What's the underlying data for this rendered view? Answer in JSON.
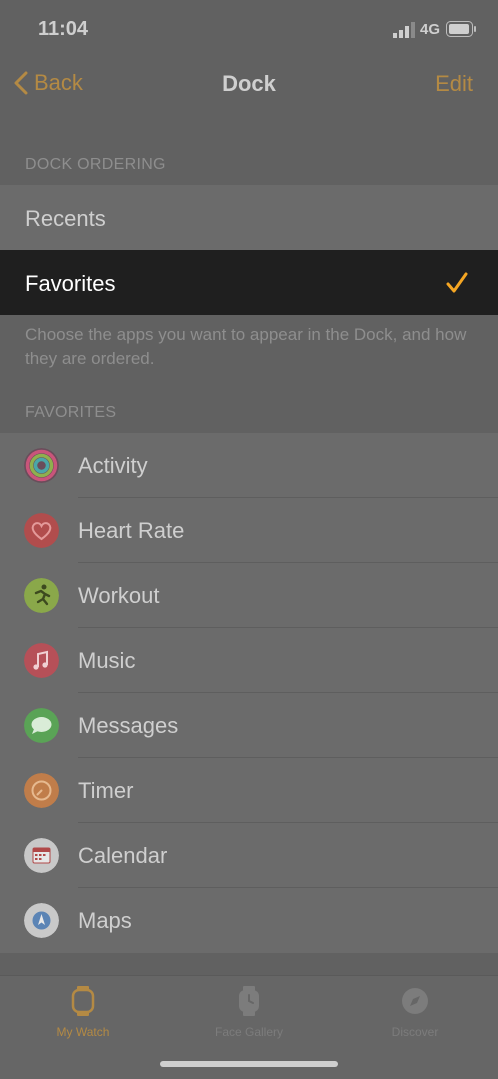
{
  "status": {
    "time": "11:04",
    "network": "4G"
  },
  "nav": {
    "back_label": "Back",
    "title": "Dock",
    "edit_label": "Edit"
  },
  "dock_ordering": {
    "header": "DOCK ORDERING",
    "options": [
      {
        "label": "Recents",
        "selected": false
      },
      {
        "label": "Favorites",
        "selected": true
      }
    ],
    "footer": "Choose the apps you want to appear in the Dock, and how they are ordered."
  },
  "favorites": {
    "header": "FAVORITES",
    "items": [
      {
        "label": "Activity",
        "icon": "activity-icon"
      },
      {
        "label": "Heart Rate",
        "icon": "heart-rate-icon"
      },
      {
        "label": "Workout",
        "icon": "workout-icon"
      },
      {
        "label": "Music",
        "icon": "music-icon"
      },
      {
        "label": "Messages",
        "icon": "messages-icon"
      },
      {
        "label": "Timer",
        "icon": "timer-icon"
      },
      {
        "label": "Calendar",
        "icon": "calendar-icon"
      },
      {
        "label": "Maps",
        "icon": "maps-icon"
      }
    ]
  },
  "tabbar": {
    "tabs": [
      {
        "label": "My Watch",
        "icon": "watch-icon",
        "active": true
      },
      {
        "label": "Face Gallery",
        "icon": "face-gallery-icon",
        "active": false
      },
      {
        "label": "Discover",
        "icon": "compass-icon",
        "active": false
      }
    ]
  },
  "colors": {
    "accent": "#b48a44",
    "check": "#f5a623",
    "background": "#616161",
    "row": "#6b6b6b",
    "selected_row": "#1f1f1f"
  }
}
